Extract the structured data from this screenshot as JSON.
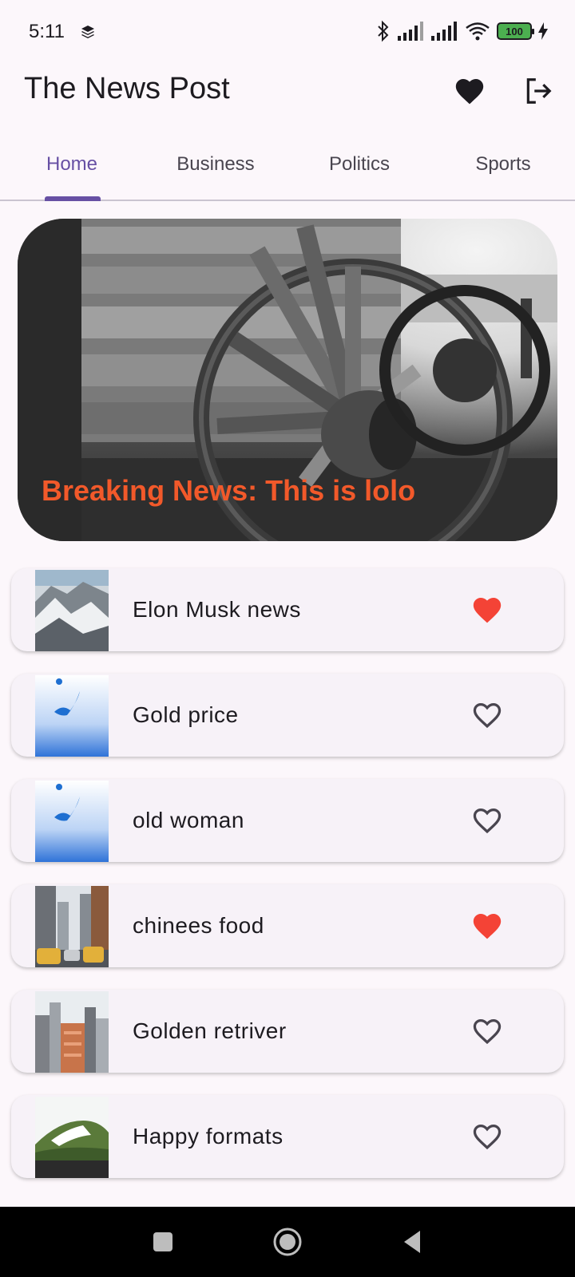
{
  "status": {
    "time": "5:11",
    "battery": "100"
  },
  "app": {
    "title": "The News Post"
  },
  "tabs": [
    {
      "label": "Home",
      "active": true
    },
    {
      "label": "Business",
      "active": false
    },
    {
      "label": "Politics",
      "active": false
    },
    {
      "label": "Sports",
      "active": false
    }
  ],
  "hero": {
    "headline": "Breaking News: This is lolo"
  },
  "news": [
    {
      "title": "Elon Musk news",
      "favorited": true,
      "thumb": "mountain"
    },
    {
      "title": "Gold price",
      "favorited": false,
      "thumb": "blue-splash"
    },
    {
      "title": "old woman",
      "favorited": false,
      "thumb": "blue-splash"
    },
    {
      "title": "chinees food",
      "favorited": true,
      "thumb": "city-street"
    },
    {
      "title": "Golden retriver",
      "favorited": false,
      "thumb": "city-skyline"
    },
    {
      "title": "Happy formats",
      "favorited": false,
      "thumb": "green-hill"
    }
  ],
  "colors": {
    "accent": "#6750a4",
    "favorite": "#f44336",
    "headline": "#f2592a",
    "background": "#fcf7fb"
  }
}
